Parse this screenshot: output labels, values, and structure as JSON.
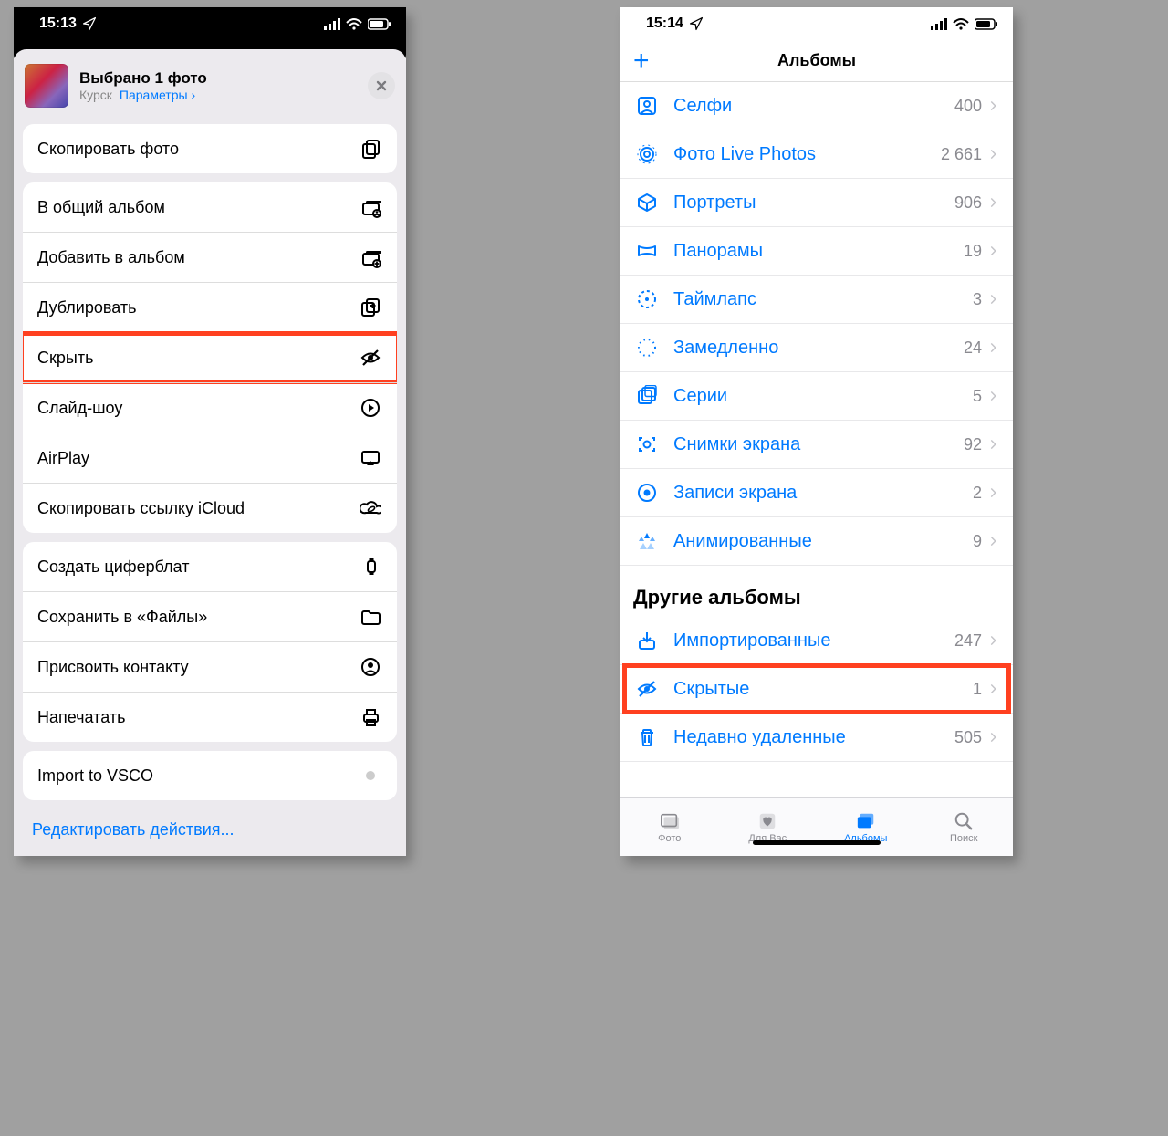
{
  "left": {
    "status_time": "15:13",
    "header": {
      "title": "Выбрано 1 фото",
      "location": "Курск",
      "options_label": "Параметры"
    },
    "sections": [
      [
        {
          "key": "copy_photo",
          "label": "Скопировать фото",
          "icon": "copy"
        }
      ],
      [
        {
          "key": "shared_album",
          "label": "В общий альбом",
          "icon": "shared-album"
        },
        {
          "key": "add_album",
          "label": "Добавить в альбом",
          "icon": "add-album"
        },
        {
          "key": "duplicate",
          "label": "Дублировать",
          "icon": "duplicate"
        },
        {
          "key": "hide",
          "label": "Скрыть",
          "icon": "eye-slash",
          "highlight": true
        },
        {
          "key": "slideshow",
          "label": "Слайд-шоу",
          "icon": "play-circle"
        },
        {
          "key": "airplay",
          "label": "AirPlay",
          "icon": "airplay"
        },
        {
          "key": "icloud_link",
          "label": "Скопировать ссылку iCloud",
          "icon": "cloud-link"
        }
      ],
      [
        {
          "key": "watchface",
          "label": "Создать циферблат",
          "icon": "watch"
        },
        {
          "key": "save_files",
          "label": "Сохранить в «Файлы»",
          "icon": "folder"
        },
        {
          "key": "assign_contact",
          "label": "Присвоить контакту",
          "icon": "contact"
        },
        {
          "key": "print",
          "label": "Напечатать",
          "icon": "print"
        }
      ],
      [
        {
          "key": "vsco",
          "label": "Import to VSCO",
          "icon": "vsco"
        }
      ]
    ],
    "edit_actions": "Редактировать действия..."
  },
  "right": {
    "status_time": "15:14",
    "header_title": "Альбомы",
    "albums": [
      {
        "key": "selfie",
        "label": "Селфи",
        "count": "400",
        "icon": "person-square"
      },
      {
        "key": "live",
        "label": "Фото Live Photos",
        "count": "2 661",
        "icon": "live"
      },
      {
        "key": "portrait",
        "label": "Портреты",
        "count": "906",
        "icon": "cube"
      },
      {
        "key": "pano",
        "label": "Панорамы",
        "count": "19",
        "icon": "pano"
      },
      {
        "key": "timelapse",
        "label": "Таймлапс",
        "count": "3",
        "icon": "timelapse"
      },
      {
        "key": "slowmo",
        "label": "Замедленно",
        "count": "24",
        "icon": "slowmo"
      },
      {
        "key": "bursts",
        "label": "Серии",
        "count": "5",
        "icon": "bursts"
      },
      {
        "key": "screenshots",
        "label": "Снимки экрана",
        "count": "92",
        "icon": "screenshot"
      },
      {
        "key": "screenrec",
        "label": "Записи экрана",
        "count": "2",
        "icon": "record"
      },
      {
        "key": "animated",
        "label": "Анимированные",
        "count": "9",
        "icon": "animated"
      }
    ],
    "other_title": "Другие альбомы",
    "other_albums": [
      {
        "key": "imported",
        "label": "Импортированные",
        "count": "247",
        "icon": "import"
      },
      {
        "key": "hidden",
        "label": "Скрытые",
        "count": "1",
        "icon": "eye-slash",
        "highlight": true
      },
      {
        "key": "deleted",
        "label": "Недавно удаленные",
        "count": "505",
        "icon": "trash"
      }
    ],
    "tabs": [
      {
        "key": "photos",
        "label": "Фото",
        "icon": "photos"
      },
      {
        "key": "foryou",
        "label": "Для Вас",
        "icon": "foryou"
      },
      {
        "key": "albums",
        "label": "Альбомы",
        "icon": "albums",
        "active": true
      },
      {
        "key": "search",
        "label": "Поиск",
        "icon": "search"
      }
    ]
  }
}
